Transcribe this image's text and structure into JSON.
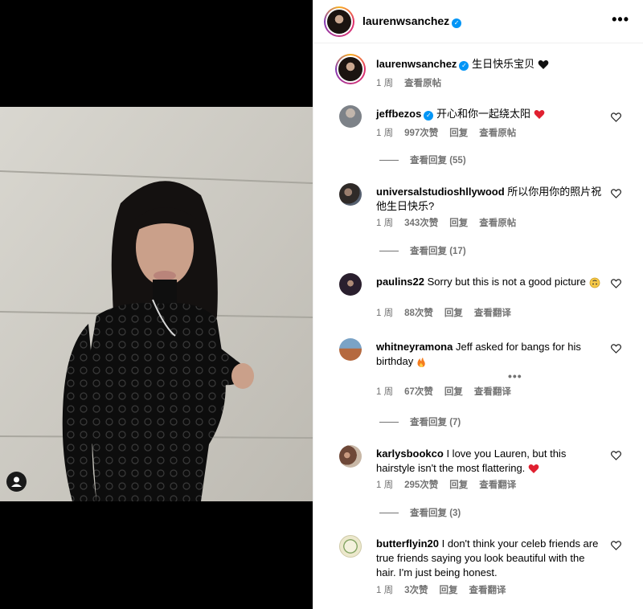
{
  "post": {
    "author": "laurenwsanchez",
    "caption": "生日快乐宝贝",
    "caption_time": "1 周",
    "caption_link": "查看原帖"
  },
  "comments": [
    {
      "user": "jeffbezos",
      "verified": true,
      "text": "开心和你一起绕太阳",
      "time": "1 周",
      "likes": "997次赞",
      "reply": "回复",
      "action": "查看原帖",
      "replies": "查看回复 (55)",
      "avatar_color": "#8a8f95"
    },
    {
      "user": "universalstudioshllywood",
      "verified": false,
      "text": "所以你用你的照片祝他生日快乐?",
      "time": "1 周",
      "likes": "343次赞",
      "reply": "回复",
      "action": "查看原帖",
      "replies": "查看回复 (17)",
      "avatar_color": "#5a4d46"
    },
    {
      "user": "paulins22",
      "verified": false,
      "text": "Sorry but this is not a good picture",
      "time": "1 周",
      "likes": "88次赞",
      "reply": "回复",
      "action": "查看翻译",
      "avatar_color": "#4a3a55"
    },
    {
      "user": "whitneyramona",
      "verified": false,
      "text": "Jeff asked for bangs for his birthday",
      "time": "1 周",
      "likes": "67次赞",
      "reply": "回复",
      "action": "查看翻译",
      "replies": "查看回复 (7)",
      "avatar_color": "#b07050"
    },
    {
      "user": "karlysbookco",
      "verified": false,
      "text": "I love you Lauren, but this hairstyle isn't the most flattering.",
      "time": "1 周",
      "likes": "295次赞",
      "reply": "回复",
      "action": "查看翻译",
      "replies": "查看回复 (3)",
      "avatar_color": "#6b4a3a"
    },
    {
      "user": "butterflyin20",
      "verified": false,
      "text": "I don't think your celeb friends are true friends saying you look beautiful with the hair. I'm just being honest.",
      "time": "1 周",
      "likes": "3次赞",
      "reply": "回复",
      "action": "查看翻译",
      "avatar_color": "#e9e6cf"
    }
  ],
  "colors": {
    "accent": "#0095f6",
    "heart_red": "#ed4956",
    "muted": "#737373"
  },
  "icons": [
    "more-icon",
    "verified-icon",
    "heart-icon",
    "black-heart-icon",
    "fire-icon",
    "upside-down-face-icon",
    "user-tag-icon"
  ]
}
